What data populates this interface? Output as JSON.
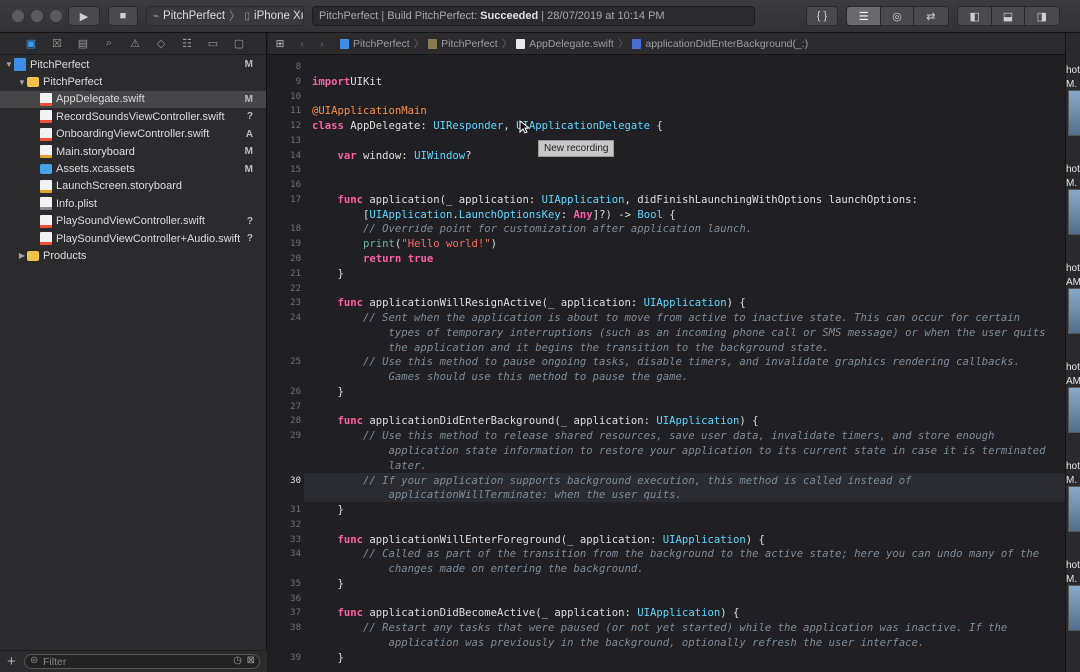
{
  "toolbar": {
    "scheme_name": "PitchPerfect",
    "scheme_sep": "〉",
    "device_name": "iPhone Xʀ",
    "activity_prefix": "PitchPerfect | Build PitchPerfect:",
    "activity_status": "Succeeded",
    "activity_suffix": "| 28/07/2019 at 10:14 PM",
    "code_review_label": "{ }"
  },
  "navigator": {
    "items": [
      {
        "label": "PitchPerfect",
        "status": "M",
        "indent": 0,
        "icon": "project",
        "disclosure": "▼"
      },
      {
        "label": "PitchPerfect",
        "status": "",
        "indent": 1,
        "icon": "folder",
        "disclosure": "▼"
      },
      {
        "label": "AppDelegate.swift",
        "status": "M",
        "indent": 2,
        "icon": "swift",
        "disclosure": "",
        "selected": true
      },
      {
        "label": "RecordSoundsViewController.swift",
        "status": "?",
        "indent": 2,
        "icon": "swift",
        "disclosure": ""
      },
      {
        "label": "OnboardingViewController.swift",
        "status": "A",
        "indent": 2,
        "icon": "swift",
        "disclosure": ""
      },
      {
        "label": "Main.storyboard",
        "status": "M",
        "indent": 2,
        "icon": "storyboard",
        "disclosure": ""
      },
      {
        "label": "Assets.xcassets",
        "status": "M",
        "indent": 2,
        "icon": "assets",
        "disclosure": ""
      },
      {
        "label": "LaunchScreen.storyboard",
        "status": "",
        "indent": 2,
        "icon": "storyboard",
        "disclosure": ""
      },
      {
        "label": "Info.plist",
        "status": "",
        "indent": 2,
        "icon": "plist",
        "disclosure": ""
      },
      {
        "label": "PlaySoundViewController.swift",
        "status": "?",
        "indent": 2,
        "icon": "swift",
        "disclosure": ""
      },
      {
        "label": "PlaySoundViewController+Audio.swift",
        "status": "?",
        "indent": 2,
        "icon": "swift",
        "disclosure": ""
      },
      {
        "label": "Products",
        "status": "",
        "indent": 1,
        "icon": "folder",
        "disclosure": "▶"
      }
    ],
    "filter_placeholder": "Filter"
  },
  "jumpbar": {
    "crumbs": [
      "PitchPerfect",
      "PitchPerfect",
      "AppDelegate.swift",
      "applicationDidEnterBackground(_:)"
    ]
  },
  "editor": {
    "current_line": 30,
    "tooltip": "New recording",
    "lines": [
      {
        "n": "8",
        "t": []
      },
      {
        "n": "9",
        "t": [
          [
            "kw",
            "import"
          ],
          [
            "",
            "UIKit"
          ]
        ]
      },
      {
        "n": "10",
        "t": []
      },
      {
        "n": "11",
        "t": [
          [
            "attr",
            "@UIApplicationMain"
          ]
        ]
      },
      {
        "n": "12",
        "t": [
          [
            "kw",
            "class"
          ],
          [
            "",
            " AppDelegate: "
          ],
          [
            "ty",
            "UIResponder"
          ],
          [
            "",
            ", "
          ],
          [
            "ty",
            "UIApplicationDelegate"
          ],
          [
            "",
            " {"
          ]
        ]
      },
      {
        "n": "13",
        "t": []
      },
      {
        "n": "14",
        "t": [
          [
            "",
            "    "
          ],
          [
            "kw",
            "var"
          ],
          [
            "",
            " window: "
          ],
          [
            "ty",
            "UIWindow"
          ],
          [
            "",
            "?"
          ]
        ]
      },
      {
        "n": "15",
        "t": []
      },
      {
        "n": "16",
        "t": []
      },
      {
        "n": "17",
        "t": [
          [
            "",
            "    "
          ],
          [
            "kw",
            "func"
          ],
          [
            "",
            " application(_ application: "
          ],
          [
            "ty",
            "UIApplication"
          ],
          [
            "",
            ", didFinishLaunchingWithOptions launchOptions:"
          ]
        ]
      },
      {
        "n": "",
        "t": [
          [
            "",
            "        ["
          ],
          [
            "ty",
            "UIApplication"
          ],
          [
            "",
            "."
          ],
          [
            "ty",
            "LaunchOptionsKey"
          ],
          [
            "",
            ": "
          ],
          [
            "kw",
            "Any"
          ],
          [
            "",
            "]?) -> "
          ],
          [
            "ty",
            "Bool"
          ],
          [
            "",
            " {"
          ]
        ]
      },
      {
        "n": "18",
        "t": [
          [
            "",
            "        "
          ],
          [
            "cm",
            "// Override point for customization after application launch."
          ]
        ]
      },
      {
        "n": "19",
        "t": [
          [
            "",
            "        "
          ],
          [
            "fn",
            "print"
          ],
          [
            "",
            "("
          ],
          [
            "str",
            "\"Hello world!\""
          ],
          [
            "",
            ")"
          ]
        ]
      },
      {
        "n": "20",
        "t": [
          [
            "",
            "        "
          ],
          [
            "kw",
            "return"
          ],
          [
            "",
            " "
          ],
          [
            "kw",
            "true"
          ]
        ]
      },
      {
        "n": "21",
        "t": [
          [
            "",
            "    }"
          ]
        ]
      },
      {
        "n": "22",
        "t": []
      },
      {
        "n": "23",
        "t": [
          [
            "",
            "    "
          ],
          [
            "kw",
            "func"
          ],
          [
            "",
            " applicationWillResignActive(_ application: "
          ],
          [
            "ty",
            "UIApplication"
          ],
          [
            "",
            ") {"
          ]
        ]
      },
      {
        "n": "24",
        "t": [
          [
            "",
            "        "
          ],
          [
            "cm",
            "// Sent when the application is about to move from active to inactive state. This can occur for certain"
          ]
        ]
      },
      {
        "n": "",
        "t": [
          [
            "",
            "            "
          ],
          [
            "cm",
            "types of temporary interruptions (such as an incoming phone call or SMS message) or when the user quits"
          ]
        ]
      },
      {
        "n": "",
        "t": [
          [
            "",
            "            "
          ],
          [
            "cm",
            "the application and it begins the transition to the background state."
          ]
        ]
      },
      {
        "n": "25",
        "t": [
          [
            "",
            "        "
          ],
          [
            "cm",
            "// Use this method to pause ongoing tasks, disable timers, and invalidate graphics rendering callbacks."
          ]
        ]
      },
      {
        "n": "",
        "t": [
          [
            "",
            "            "
          ],
          [
            "cm",
            "Games should use this method to pause the game."
          ]
        ]
      },
      {
        "n": "26",
        "t": [
          [
            "",
            "    }"
          ]
        ]
      },
      {
        "n": "27",
        "t": []
      },
      {
        "n": "28",
        "t": [
          [
            "",
            "    "
          ],
          [
            "kw",
            "func"
          ],
          [
            "",
            " applicationDidEnterBackground(_ application: "
          ],
          [
            "ty",
            "UIApplication"
          ],
          [
            "",
            ") {"
          ]
        ]
      },
      {
        "n": "29",
        "t": [
          [
            "",
            "        "
          ],
          [
            "cm",
            "// Use this method to release shared resources, save user data, invalidate timers, and store enough"
          ]
        ]
      },
      {
        "n": "",
        "t": [
          [
            "",
            "            "
          ],
          [
            "cm",
            "application state information to restore your application to its current state in case it is terminated"
          ]
        ]
      },
      {
        "n": "",
        "t": [
          [
            "",
            "            "
          ],
          [
            "cm",
            "later."
          ]
        ]
      },
      {
        "n": "30",
        "t": [
          [
            "",
            "        "
          ],
          [
            "cm",
            "// If your application supports background execution, this method is called instead of"
          ]
        ]
      },
      {
        "n": "",
        "t": [
          [
            "",
            "            "
          ],
          [
            "cm",
            "applicationWillTerminate: when the user quits."
          ]
        ]
      },
      {
        "n": "31",
        "t": [
          [
            "",
            "    }"
          ]
        ]
      },
      {
        "n": "32",
        "t": []
      },
      {
        "n": "33",
        "t": [
          [
            "",
            "    "
          ],
          [
            "kw",
            "func"
          ],
          [
            "",
            " applicationWillEnterForeground(_ application: "
          ],
          [
            "ty",
            "UIApplication"
          ],
          [
            "",
            ") {"
          ]
        ]
      },
      {
        "n": "34",
        "t": [
          [
            "",
            "        "
          ],
          [
            "cm",
            "// Called as part of the transition from the background to the active state; here you can undo many of the"
          ]
        ]
      },
      {
        "n": "",
        "t": [
          [
            "",
            "            "
          ],
          [
            "cm",
            "changes made on entering the background."
          ]
        ]
      },
      {
        "n": "35",
        "t": [
          [
            "",
            "    }"
          ]
        ]
      },
      {
        "n": "36",
        "t": []
      },
      {
        "n": "37",
        "t": [
          [
            "",
            "    "
          ],
          [
            "kw",
            "func"
          ],
          [
            "",
            " applicationDidBecomeActive(_ application: "
          ],
          [
            "ty",
            "UIApplication"
          ],
          [
            "",
            ") {"
          ]
        ]
      },
      {
        "n": "38",
        "t": [
          [
            "",
            "        "
          ],
          [
            "cm",
            "// Restart any tasks that were paused (or not yet started) while the application was inactive. If the"
          ]
        ]
      },
      {
        "n": "",
        "t": [
          [
            "",
            "            "
          ],
          [
            "cm",
            "application was previously in the background, optionally refresh the user interface."
          ]
        ]
      },
      {
        "n": "39",
        "t": [
          [
            "",
            "    }"
          ]
        ]
      }
    ]
  },
  "right_strip": {
    "labels": [
      "hot",
      "M.",
      "hot",
      "M.",
      "hot",
      "AM",
      "hot",
      "AM",
      "hot",
      "M.",
      "hot",
      "M."
    ]
  },
  "colors": {
    "keyword": "#fc5fa3",
    "type": "#5dd8ff",
    "comment": "#7f8c98",
    "string": "#fc6a5d",
    "selection_accent": "#3b9cff"
  }
}
